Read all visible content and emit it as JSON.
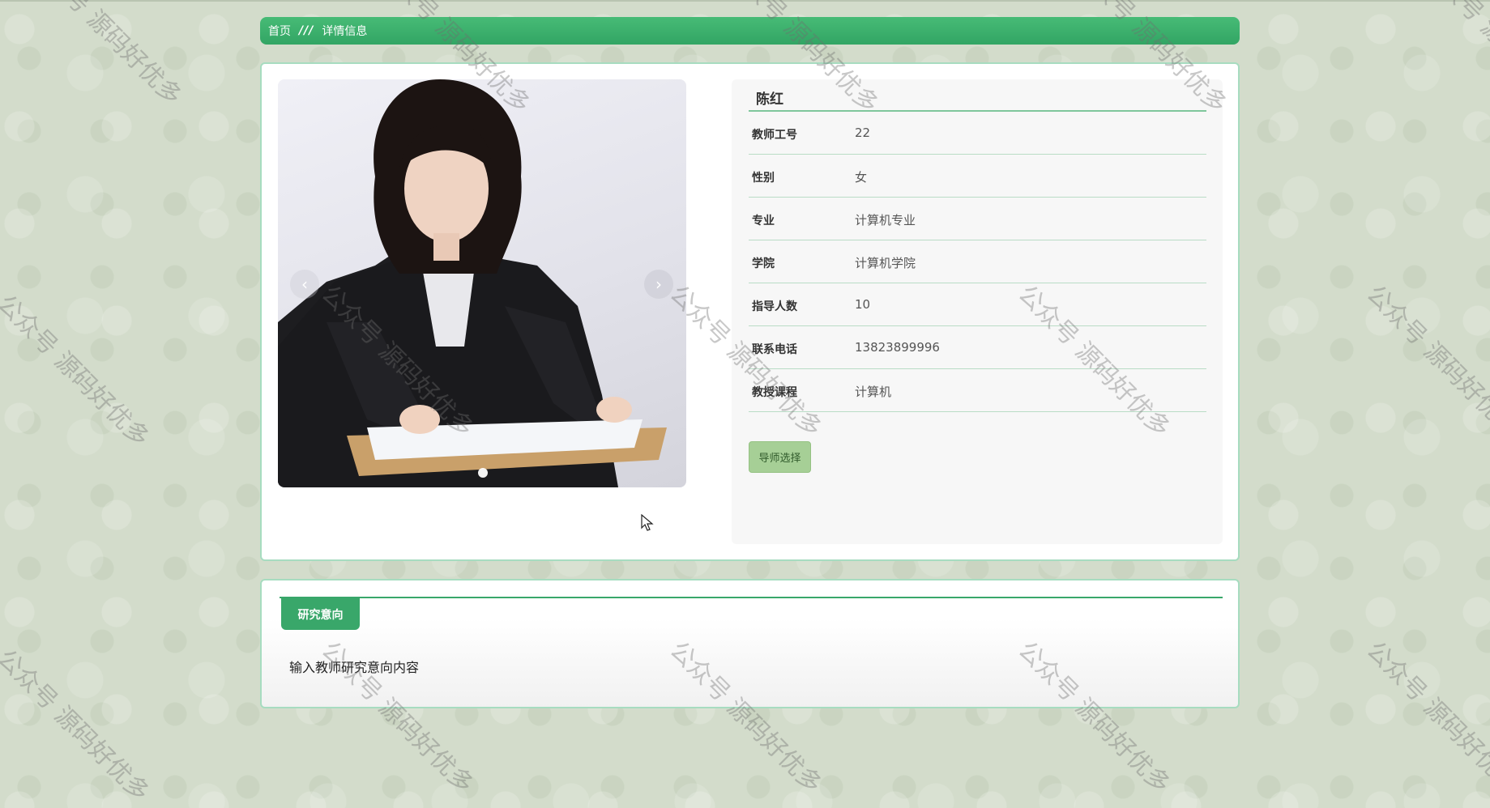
{
  "breadcrumb": {
    "home": "首页",
    "separator": "///",
    "current": "详情信息"
  },
  "teacher": {
    "name": "陈红",
    "fields": [
      {
        "label": "教师工号",
        "value": "22"
      },
      {
        "label": "性别",
        "value": "女"
      },
      {
        "label": "专业",
        "value": "计算机专业"
      },
      {
        "label": "学院",
        "value": "计算机学院"
      },
      {
        "label": "指导人数",
        "value": "10"
      },
      {
        "label": "联系电话",
        "value": "13823899996"
      },
      {
        "label": "教授课程",
        "value": "计算机"
      }
    ],
    "action_button": "导师选择"
  },
  "carousel": {
    "prev_icon": "‹",
    "next_icon": "›",
    "slide_count": 1
  },
  "research": {
    "tab_label": "研究意向",
    "content": "输入教师研究意向内容"
  },
  "watermark": "公众号 源码好优多",
  "colors": {
    "accent_green": "#3aa96b",
    "button_green": "#a6cf96"
  }
}
